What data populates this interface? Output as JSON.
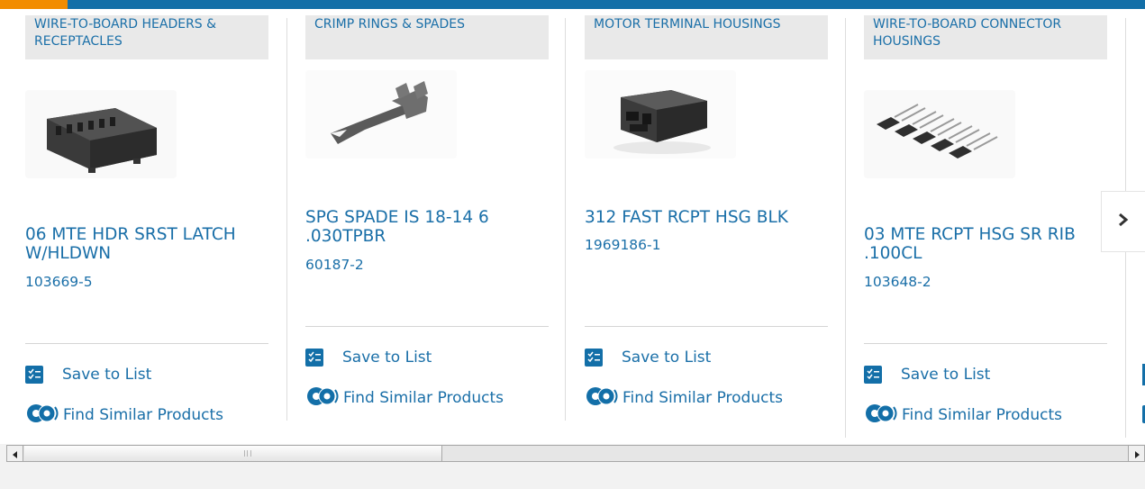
{
  "cards": [
    {
      "category": "WIRE-TO-BOARD HEADERS & RECEPTACLES",
      "title": "06 MTE HDR SRST LATCH W/HLDWN",
      "part_number": "103669-5",
      "image_icon": "wire-to-board-header-image",
      "save_label": "Save to List",
      "similar_label": "Find Similar Products"
    },
    {
      "category": "CRIMP RINGS & SPADES",
      "title": "SPG SPADE IS 18-14 6 .030TPBR",
      "part_number": "60187-2",
      "image_icon": "spade-terminal-image",
      "save_label": "Save to List",
      "similar_label": "Find Similar Products"
    },
    {
      "category": "MOTOR TERMINAL HOUSINGS",
      "title": "312 FAST RCPT HSG BLK",
      "part_number": "1969186-1",
      "image_icon": "terminal-housing-image",
      "save_label": "Save to List",
      "similar_label": "Find Similar Products"
    },
    {
      "category": "WIRE-TO-BOARD CONNECTOR HOUSINGS",
      "title": "03 MTE RCPT HSG SR RIB .100CL",
      "part_number": "103648-2",
      "image_icon": "connector-housing-image",
      "save_label": "Save to List",
      "similar_label": "Find Similar Products"
    }
  ],
  "carousel": {
    "next_icon": "chevron-right-icon"
  },
  "colors": {
    "accent_orange": "#f28c00",
    "brand_blue": "#136fa8",
    "link_blue": "#1a6fa8"
  }
}
